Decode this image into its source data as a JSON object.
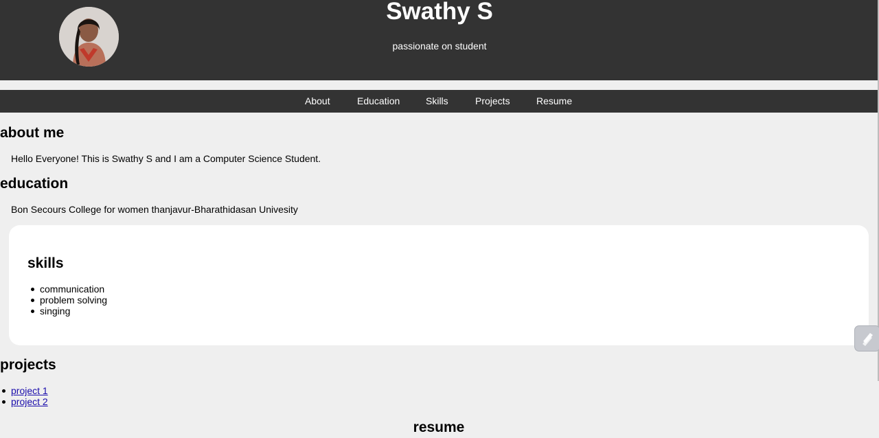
{
  "header": {
    "name": "Swathy S",
    "tagline": "passionate on student",
    "avatar_alt": "profile photo"
  },
  "nav": {
    "items": [
      {
        "label": "About"
      },
      {
        "label": "Education"
      },
      {
        "label": "Skills"
      },
      {
        "label": "Projects"
      },
      {
        "label": "Resume"
      }
    ]
  },
  "about": {
    "heading": "about me",
    "text": "Hello Everyone! This is Swathy S and I am a Computer Science Student."
  },
  "education": {
    "heading": "education",
    "text": "Bon Secours College for women thanjavur-Bharathidasan Univesity"
  },
  "skills": {
    "heading": "skills",
    "items": [
      "communication",
      "problem solving",
      "singing"
    ]
  },
  "projects": {
    "heading": "projects",
    "items": [
      "project 1",
      "project 2"
    ]
  },
  "resume": {
    "heading": "resume"
  },
  "colors": {
    "header_bg": "#333333",
    "page_bg": "#efefef",
    "card_bg": "#ffffff",
    "link": "#1a0dab"
  },
  "icons": {
    "floating_button": "extension-icon"
  }
}
